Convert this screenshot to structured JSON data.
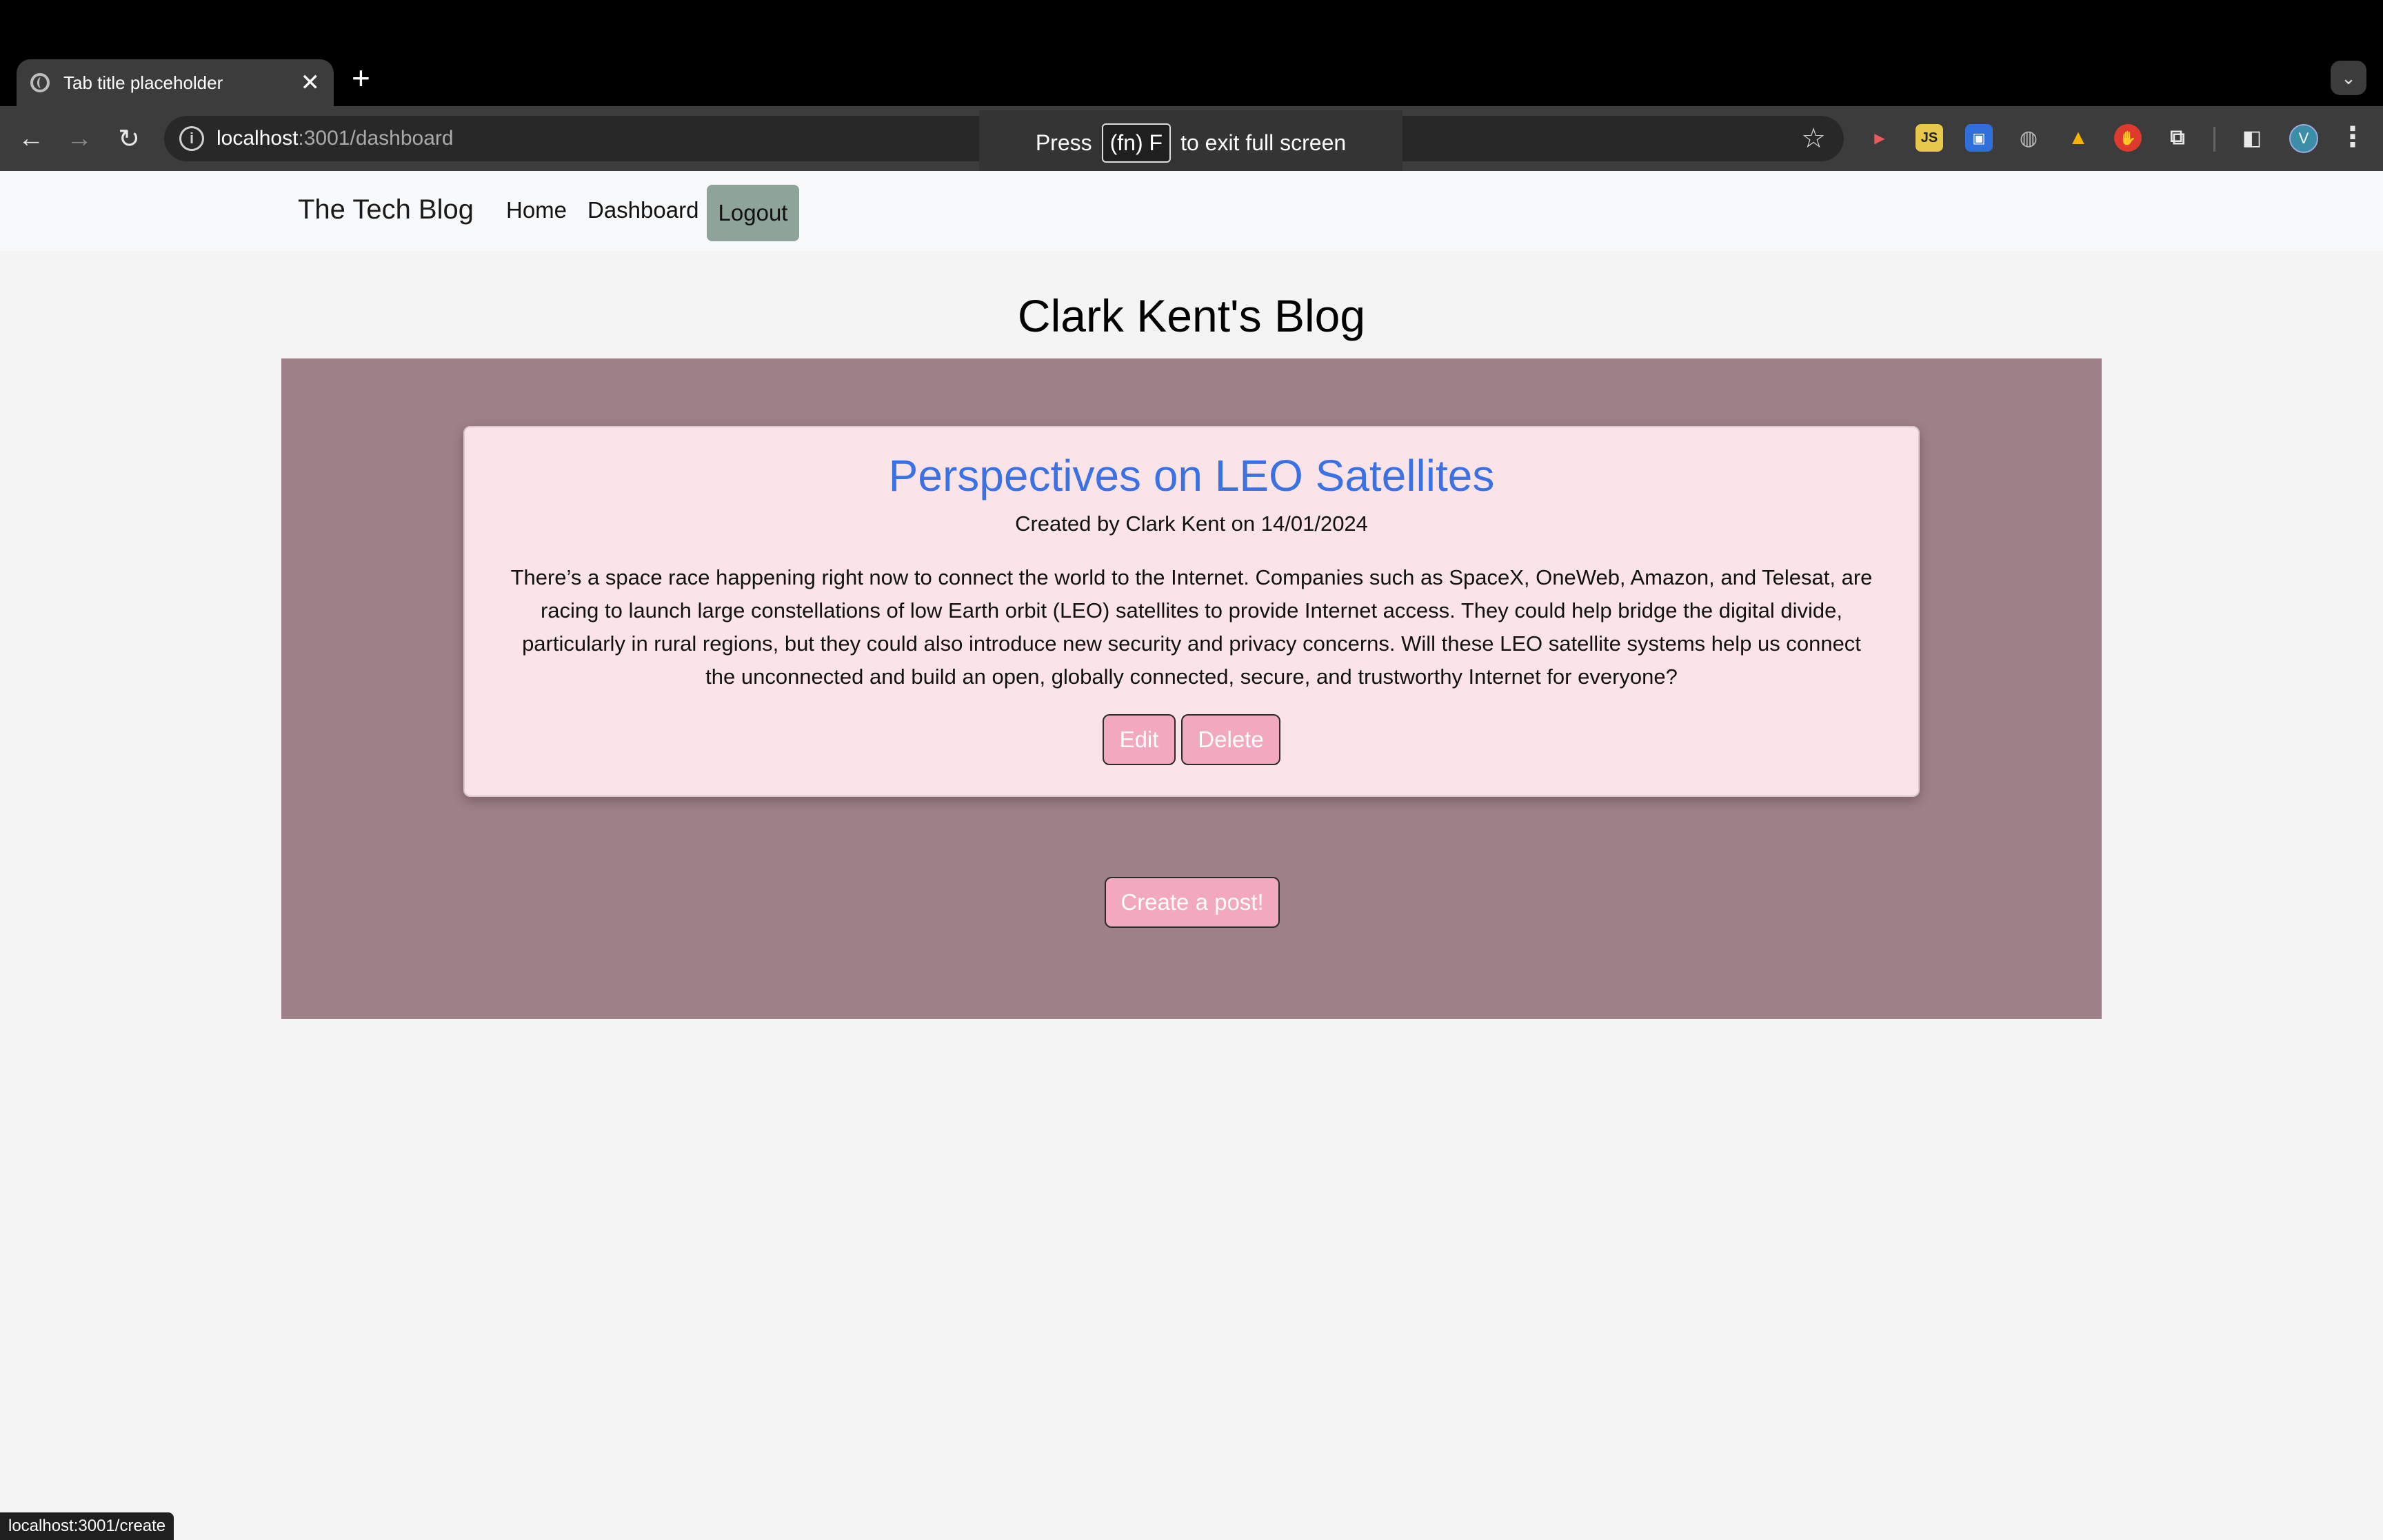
{
  "browser": {
    "tab_title": "Tab title placeholder",
    "tab_close": "✕",
    "new_tab": "+",
    "tab_menu": "⌄",
    "url_host": "localhost",
    "url_path": ":3001/dashboard",
    "info_icon": "i",
    "back": "←",
    "forward": "→",
    "reload": "↻",
    "star": "☆",
    "profile_initial": "V",
    "menu": "⋮",
    "toast": {
      "press": "Press",
      "key": "(fn) F",
      "rest": "to exit full screen"
    },
    "status_url": "localhost:3001/create",
    "extension_icons": [
      "record-icon",
      "js-icon",
      "bitwarden-icon",
      "globe-icon",
      "drive-icon",
      "hand-icon",
      "puzzle-icon"
    ]
  },
  "navbar": {
    "brand": "The Tech Blog",
    "links": [
      "Home",
      "Dashboard"
    ],
    "logout": "Logout"
  },
  "page": {
    "title": "Clark Kent's Blog"
  },
  "post": {
    "title": "Perspectives on LEO Satellites",
    "meta": "Created by Clark Kent on 14/01/2024",
    "body": "There’s a space race happening right now to connect the world to the Internet. Companies such as SpaceX, OneWeb, Amazon, and Telesat, are racing to launch large constellations of low Earth orbit (LEO) satellites to provide Internet access. They could help bridge the digital divide, particularly in rural regions, but they could also introduce new security and privacy concerns. Will these LEO satellite systems help us connect the unconnected and build an open, globally connected, secure, and trustworthy Internet for everyone?",
    "edit": "Edit",
    "delete": "Delete"
  },
  "create_button": "Create a post!",
  "colors": {
    "panel": "#9e8188",
    "card": "#fbe4e8",
    "post_title": "#3a72e6",
    "pink_button": "#f2a8bd",
    "logout_button": "#8ea39a"
  }
}
